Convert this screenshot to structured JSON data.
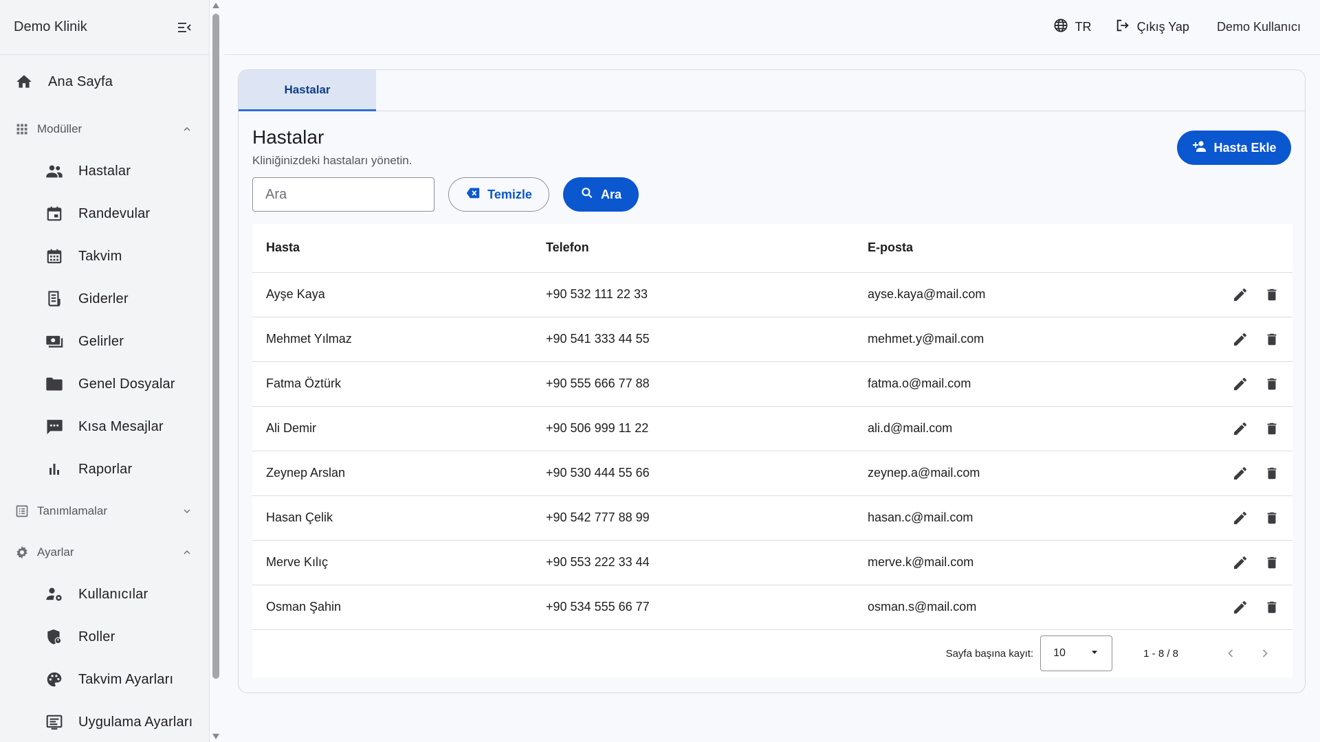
{
  "sidebar": {
    "brand": "Demo Klinik",
    "home": "Ana Sayfa",
    "groups": {
      "modules": "Modüller",
      "definitions": "Tanımlamalar",
      "settings": "Ayarlar"
    },
    "modules": [
      "Hastalar",
      "Randevular",
      "Takvim",
      "Giderler",
      "Gelirler",
      "Genel Dosyalar",
      "Kısa Mesajlar",
      "Raporlar"
    ],
    "settings": [
      "Kullanıcılar",
      "Roller",
      "Takvim Ayarları",
      "Uygulama Ayarları"
    ]
  },
  "header": {
    "language": "TR",
    "logout": "Çıkış Yap",
    "user": "Demo Kullanıcı"
  },
  "tab": {
    "label": "Hastalar"
  },
  "page": {
    "title": "Hastalar",
    "subtitle": "Kliniğinizdeki hastaları yönetin.",
    "add_button": "Hasta Ekle"
  },
  "search": {
    "placeholder": "Ara",
    "clear_label": "Temizle",
    "search_label": "Ara"
  },
  "table": {
    "columns": [
      "Hasta",
      "Telefon",
      "E-posta"
    ],
    "rows": [
      [
        "Ayşe Kaya",
        "+90 532 111 22 33",
        "ayse.kaya@mail.com"
      ],
      [
        "Mehmet Yılmaz",
        "+90 541 333 44 55",
        "mehmet.y@mail.com"
      ],
      [
        "Fatma Öztürk",
        "+90 555 666 77 88",
        "fatma.o@mail.com"
      ],
      [
        "Ali Demir",
        "+90 506 999 11 22",
        "ali.d@mail.com"
      ],
      [
        "Zeynep Arslan",
        "+90 530 444 55 66",
        "zeynep.a@mail.com"
      ],
      [
        "Hasan Çelik",
        "+90 542 777 88 99",
        "hasan.c@mail.com"
      ],
      [
        "Merve Kılıç",
        "+90 553 222 33 44",
        "merve.k@mail.com"
      ],
      [
        "Osman Şahin",
        "+90 534 555 66 77",
        "osman.s@mail.com"
      ]
    ]
  },
  "pager": {
    "per_page_label": "Sayfa başına kayıt:",
    "per_page_value": "10",
    "range": "1 - 8 / 8"
  },
  "colors": {
    "primary": "#0b57d0",
    "tab_bg": "#dde5f4",
    "icon": "#3c3c41"
  }
}
